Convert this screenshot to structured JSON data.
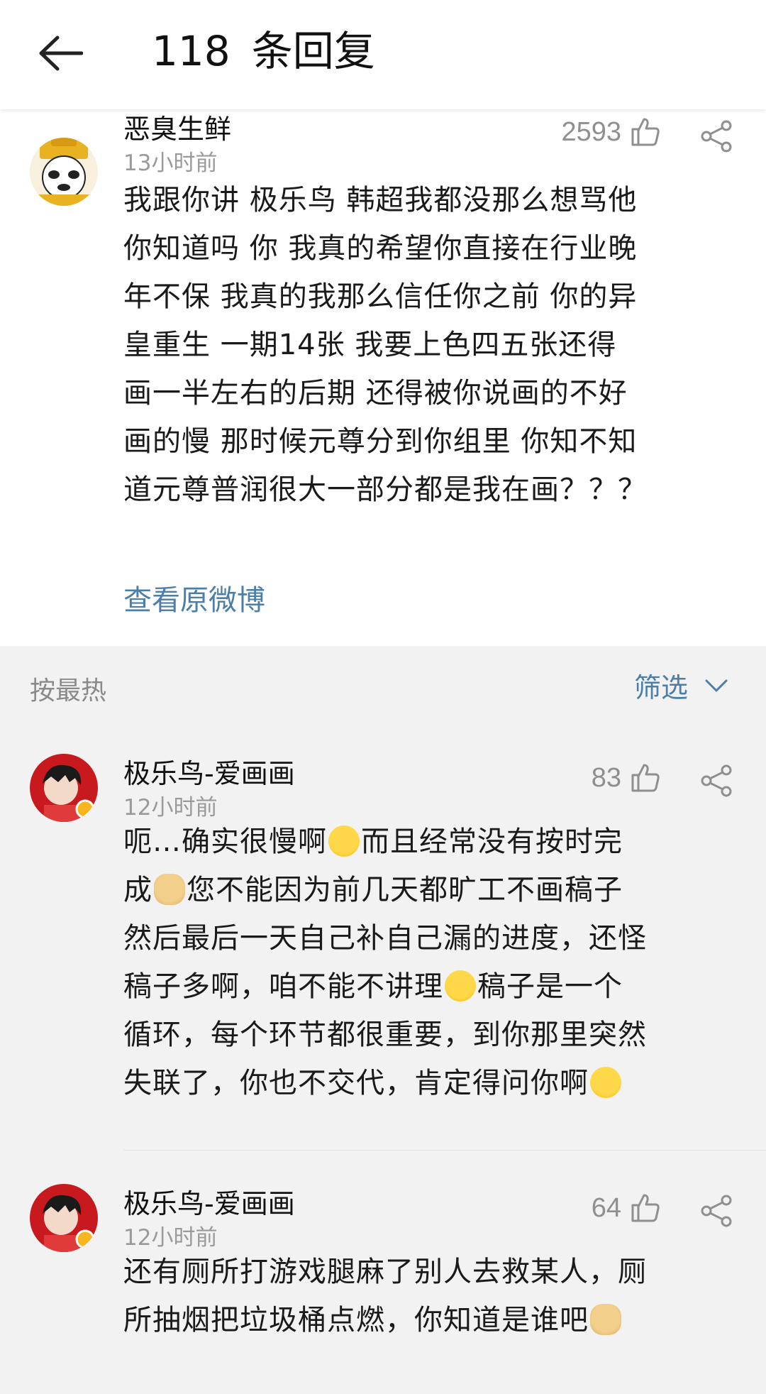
{
  "header": {
    "count": "118",
    "title": "条回复"
  },
  "post": {
    "author": "恶臭生鲜",
    "time": "13小时前",
    "likes": "2593",
    "lines": [
      "我跟你讲 极乐鸟 韩超我都没那么想骂他",
      "你知道吗 你 我真的希望你直接在行业晚",
      "年不保 我真的我那么信任你之前 你的异",
      "皇重生 一期14张 我要上色四五张还得",
      "画一半左右的后期 还得被你说画的不好",
      "画的慢 那时候元尊分到你组里 你知不知",
      "道元尊普润很大一部分都是我在画？？？"
    ],
    "view_original": "查看原微博"
  },
  "sort": {
    "label": "按最热",
    "filter": "筛选"
  },
  "comments": [
    {
      "author": "极乐鸟-爱画画",
      "time": "12小时前",
      "likes": "83",
      "lines": {
        "l1a": "呃…确实很慢啊",
        "l1b": "而且经常没有按时完",
        "l2a": "成",
        "l2b": "您不能因为前几天都旷工不画稿子",
        "l3": "然后最后一天自己补自己漏的进度，还怪",
        "l4a": "稿子多啊，咱不能不讲理",
        "l4b": "稿子是一个",
        "l5": "循环，每个环节都很重要，到你那里突然",
        "l6a": "失联了，你也不交代，肯定得问你啊"
      }
    },
    {
      "author": "极乐鸟-爱画画",
      "time": "12小时前",
      "likes": "64",
      "lines": {
        "l1": "还有厕所打游戏腿麻了别人去救某人，厕",
        "l2a": "所抽烟把垃圾桶点燃，你知道是谁吧"
      }
    }
  ]
}
